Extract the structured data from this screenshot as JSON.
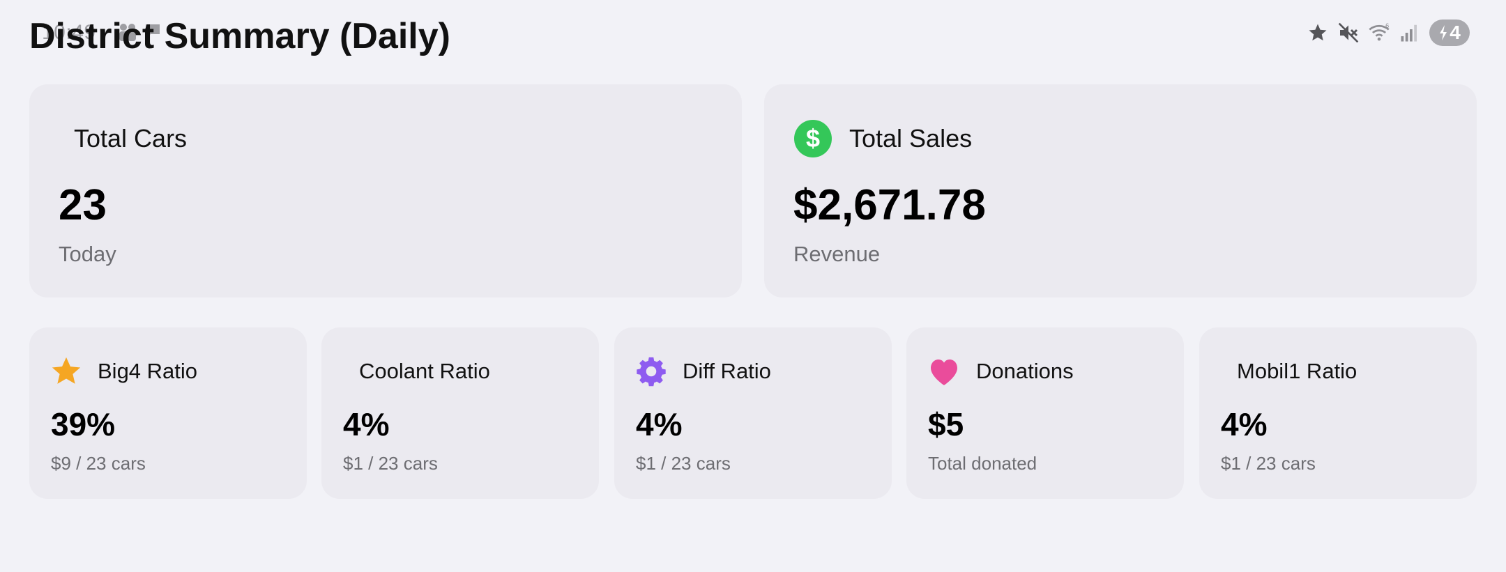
{
  "status_bar": {
    "time": "10:49",
    "battery_level": "4",
    "icons": [
      "people-icon",
      "message-icon",
      "star-icon",
      "mute-icon",
      "wifi-icon",
      "signal-icon",
      "battery-icon"
    ]
  },
  "page": {
    "title": "District Summary (Daily)"
  },
  "summary_cards": [
    {
      "label": "Total Cars",
      "value": "23",
      "sub": "Today",
      "icon": null
    },
    {
      "label": "Total Sales",
      "value": "$2,671.78",
      "sub": "Revenue",
      "icon": "dollar-icon",
      "icon_color": "#34c759"
    }
  ],
  "metric_cards": [
    {
      "label": "Big4 Ratio",
      "value": "39%",
      "sub": "$9 / 23 cars",
      "icon": "star-icon",
      "icon_color": "#f5a623"
    },
    {
      "label": "Coolant Ratio",
      "value": "4%",
      "sub": "$1 / 23 cars",
      "icon": null
    },
    {
      "label": "Diff Ratio",
      "value": "4%",
      "sub": "$1 / 23 cars",
      "icon": "gear-icon",
      "icon_color": "#8e5cf0"
    },
    {
      "label": "Donations",
      "value": "$5",
      "sub": "Total donated",
      "icon": "heart-icon",
      "icon_color": "#ea4c9b"
    },
    {
      "label": "Mobil1 Ratio",
      "value": "4%",
      "sub": "$1 / 23 cars",
      "icon": null
    }
  ],
  "colors": {
    "background": "#f2f2f7",
    "card": "#ebeaf0",
    "secondary_text": "#6d6d72"
  }
}
